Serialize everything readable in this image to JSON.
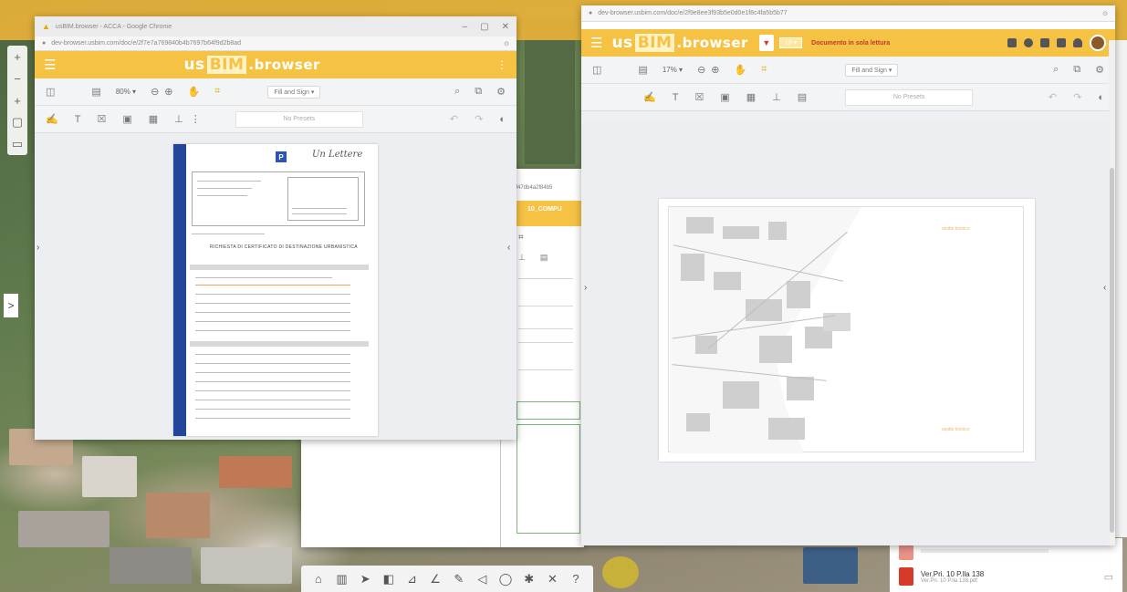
{
  "map": {
    "toolbar_icons": [
      "home-icon",
      "building-icon",
      "cursor-icon",
      "layers-icon",
      "measure-icon",
      "angle-icon",
      "pencil-icon",
      "pin-icon",
      "globe-icon",
      "settings-icon",
      "fullscreen-icon",
      "help-icon"
    ],
    "help_label": "?",
    "expand_label": ">",
    "nav": {
      "zoom_in": "+",
      "zoom_out": "−",
      "pan": "+"
    },
    "recent_files": [
      {
        "title": "Ver.Pri. 10 P.lla 138",
        "sub": "Ver.Pri. 10 P.lla 138.pdf"
      }
    ]
  },
  "left_window": {
    "title": "usBIM.browser - ACCA - Google Chrome",
    "url": "dev-browser.usbim.com/doc/e/2f7e7a769840b4b7697b64f9d2b8ad",
    "app": {
      "logo_us": "us",
      "logo_bim": "BIM",
      "logo_browser": ".browser",
      "menu": "⋮"
    },
    "toolbar1": {
      "zoom": "80% ▾",
      "fit": "Fill and Sign ▾"
    },
    "toolbar2": {
      "placeholder": "No Presets"
    },
    "document": {
      "signature": "Un Lettere",
      "logo": "P",
      "heading": "RICHIESTA DI CERTIFICATO DI DESTINAZIONE URBANISTICA",
      "nav_left": "›",
      "nav_right": "‹"
    }
  },
  "middle_window": {
    "tab_text": "7f47db4a2f84b5",
    "app_snippet": "10_COMPU"
  },
  "right_window": {
    "url": "dev-browser.usbim.com/doc/e/2f9e8ee3f93b5e0d0e1f8c4fa5b5b77",
    "app": {
      "logo_us": "us",
      "logo_bim": "BIM",
      "logo_browser": ".browser",
      "readonly": "Documento in sola lettura",
      "page_chip": "10 ▾"
    },
    "toolbar1": {
      "zoom": "17% ▾",
      "fit": "Fill and Sign ▾"
    },
    "toolbar2": {
      "placeholder": "No Presets"
    },
    "nav_left": "›",
    "nav_right": "‹",
    "stamp_top": "studio tecnico",
    "stamp_bottom": "studio tecnico"
  },
  "colors": {
    "accent": "#f6c244",
    "doc_strip": "#23469a",
    "pdf_red": "#d73a2a"
  }
}
